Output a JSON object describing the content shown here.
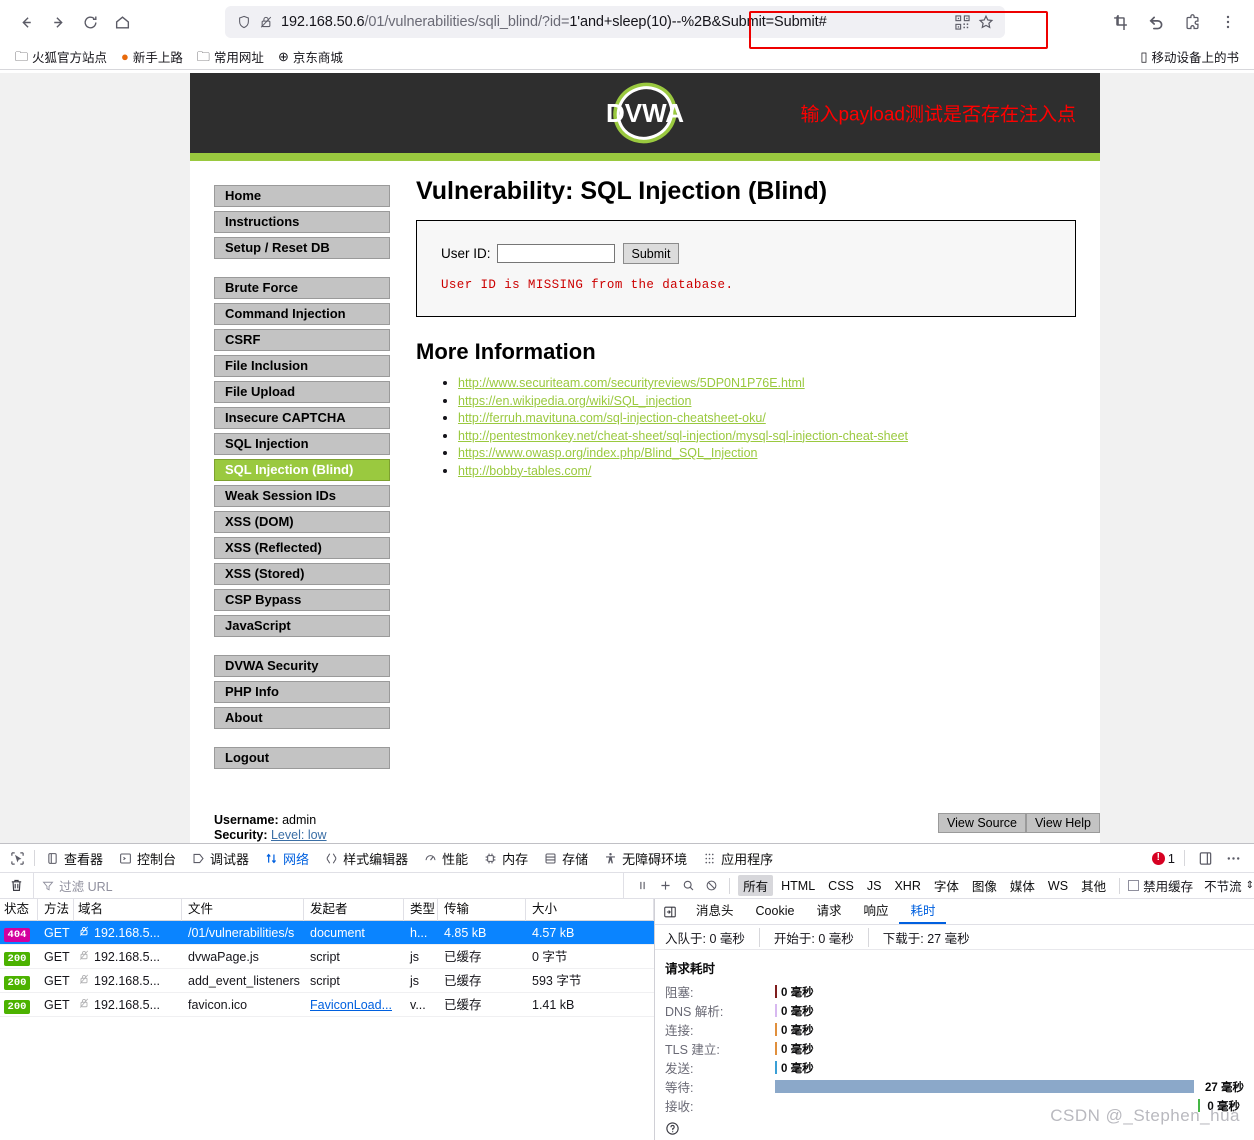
{
  "browser": {
    "nav": {
      "back": "back-arrow",
      "forward": "forward-arrow",
      "reload": "reload",
      "home": "home"
    },
    "url": {
      "host": "192.168.50.6",
      "path": "/01/vulnerabilities/sqli_blind/?id=",
      "query": "1'and+sleep(10)--%2B&Submit=Submit#",
      "full": "192.168.50.6/01/vulnerabilities/sqli_blind/?id=1'and+sleep(10)--%2B&Submit=Submit#"
    },
    "bookmarks": [
      {
        "label": "火狐官方站点",
        "icon": "folder-icon"
      },
      {
        "label": "新手上路",
        "icon": "firefox-icon"
      },
      {
        "label": "常用网址",
        "icon": "folder-icon"
      },
      {
        "label": "京东商城",
        "icon": "globe-icon"
      }
    ],
    "bookmarks_right": {
      "label": "移动设备上的书",
      "icon": "mobile-icon"
    }
  },
  "dvwa": {
    "logo": "DVWA",
    "header_annotation": "输入payload测试是否存在注入点",
    "menu_groups": [
      {
        "items": [
          {
            "label": "Home",
            "active": false
          },
          {
            "label": "Instructions",
            "active": false
          },
          {
            "label": "Setup / Reset DB",
            "active": false
          }
        ]
      },
      {
        "items": [
          {
            "label": "Brute Force",
            "active": false
          },
          {
            "label": "Command Injection",
            "active": false
          },
          {
            "label": "CSRF",
            "active": false
          },
          {
            "label": "File Inclusion",
            "active": false
          },
          {
            "label": "File Upload",
            "active": false
          },
          {
            "label": "Insecure CAPTCHA",
            "active": false
          },
          {
            "label": "SQL Injection",
            "active": false
          },
          {
            "label": "SQL Injection (Blind)",
            "active": true
          },
          {
            "label": "Weak Session IDs",
            "active": false
          },
          {
            "label": "XSS (DOM)",
            "active": false
          },
          {
            "label": "XSS (Reflected)",
            "active": false
          },
          {
            "label": "XSS (Stored)",
            "active": false
          },
          {
            "label": "CSP Bypass",
            "active": false
          },
          {
            "label": "JavaScript",
            "active": false
          }
        ]
      },
      {
        "items": [
          {
            "label": "DVWA Security",
            "active": false
          },
          {
            "label": "PHP Info",
            "active": false
          },
          {
            "label": "About",
            "active": false
          }
        ]
      },
      {
        "items": [
          {
            "label": "Logout",
            "active": false
          }
        ]
      }
    ],
    "title": "Vulnerability: SQL Injection (Blind)",
    "form": {
      "label": "User ID:",
      "input_value": "",
      "input_placeholder": "",
      "submit_label": "Submit"
    },
    "result_message": "User ID is MISSING from the database.",
    "more_info_title": "More Information",
    "more_info_links": [
      "http://www.securiteam.com/securityreviews/5DP0N1P76E.html",
      "https://en.wikipedia.org/wiki/SQL_injection",
      "http://ferruh.mavituna.com/sql-injection-cheatsheet-oku/",
      "http://pentestmonkey.net/cheat-sheet/sql-injection/mysql-sql-injection-cheat-sheet",
      "https://www.owasp.org/index.php/Blind_SQL_Injection",
      "http://bobby-tables.com/"
    ],
    "footer": {
      "username_label": "Username:",
      "username_value": "admin",
      "security_label": "Security:",
      "security_value": "Level: low"
    },
    "view_source_label": "View Source",
    "view_help_label": "View Help"
  },
  "devtools": {
    "tabs": [
      {
        "label": "查看器",
        "icon": "inspector-icon",
        "active": false
      },
      {
        "label": "控制台",
        "icon": "console-icon",
        "active": false
      },
      {
        "label": "调试器",
        "icon": "debugger-icon",
        "active": false
      },
      {
        "label": "网络",
        "icon": "network-icon",
        "active": true
      },
      {
        "label": "样式编辑器",
        "icon": "style-editor-icon",
        "active": false
      },
      {
        "label": "性能",
        "icon": "performance-icon",
        "active": false
      },
      {
        "label": "内存",
        "icon": "memory-icon",
        "active": false
      },
      {
        "label": "存储",
        "icon": "storage-icon",
        "active": false
      },
      {
        "label": "无障碍环境",
        "icon": "accessibility-icon",
        "active": false
      },
      {
        "label": "应用程序",
        "icon": "application-icon",
        "active": false
      }
    ],
    "error_count": "1",
    "filter_placeholder": "过滤 URL",
    "filter_buttons": [
      {
        "label": "所有",
        "on": true
      },
      {
        "label": "HTML",
        "on": false
      },
      {
        "label": "CSS",
        "on": false
      },
      {
        "label": "JS",
        "on": false
      },
      {
        "label": "XHR",
        "on": false
      },
      {
        "label": "字体",
        "on": false
      },
      {
        "label": "图像",
        "on": false
      },
      {
        "label": "媒体",
        "on": false
      },
      {
        "label": "WS",
        "on": false
      },
      {
        "label": "其他",
        "on": false
      }
    ],
    "disable_cache_label": "禁用缓存",
    "throttle_label": "不节流",
    "columns": [
      "状态",
      "方法",
      "域名",
      "文件",
      "发起者",
      "类型",
      "传输",
      "大小"
    ],
    "requests": [
      {
        "status": "404",
        "status_type": "404",
        "method": "GET",
        "domain": "192.168.5...",
        "file": "/01/vulnerabilities/s",
        "initiator": "document",
        "type": "h...",
        "transfer": "4.85 kB",
        "size": "4.57 kB",
        "selected": true,
        "initiator_link": false
      },
      {
        "status": "200",
        "status_type": "200",
        "method": "GET",
        "domain": "192.168.5...",
        "file": "dvwaPage.js",
        "initiator": "script",
        "type": "js",
        "transfer": "已缓存",
        "size": "0 字节",
        "selected": false,
        "initiator_link": false
      },
      {
        "status": "200",
        "status_type": "200",
        "method": "GET",
        "domain": "192.168.5...",
        "file": "add_event_listeners",
        "initiator": "script",
        "type": "js",
        "transfer": "已缓存",
        "size": "593 字节",
        "selected": false,
        "initiator_link": false
      },
      {
        "status": "200",
        "status_type": "200",
        "method": "GET",
        "domain": "192.168.5...",
        "file": "favicon.ico",
        "initiator": "FaviconLoad...",
        "type": "v...",
        "transfer": "已缓存",
        "size": "1.41 kB",
        "selected": false,
        "initiator_link": true
      }
    ],
    "detail_tabs": [
      {
        "label": "消息头",
        "active": false
      },
      {
        "label": "Cookie",
        "active": false
      },
      {
        "label": "请求",
        "active": false
      },
      {
        "label": "响应",
        "active": false
      },
      {
        "label": "耗时",
        "active": true
      }
    ],
    "detail_summary": [
      "入队于: 0 毫秒",
      "开始于: 0 毫秒",
      "下载于: 27 毫秒"
    ],
    "timing_title": "请求耗时",
    "timings": [
      {
        "label": "阻塞:",
        "value": "0 毫秒",
        "pct": 0,
        "color": "#7f1d1d"
      },
      {
        "label": "DNS 解析:",
        "value": "0 毫秒",
        "pct": 0,
        "color": "#d7b8f0"
      },
      {
        "label": "连接:",
        "value": "0 毫秒",
        "pct": 0,
        "color": "#e08f3c"
      },
      {
        "label": "TLS 建立:",
        "value": "0 毫秒",
        "pct": 0,
        "color": "#e08f3c"
      },
      {
        "label": "发送:",
        "value": "0 毫秒",
        "pct": 0,
        "color": "#3a9fd6"
      },
      {
        "label": "等待:",
        "value": "27 毫秒",
        "pct": 100,
        "color": "#8ba8c9"
      },
      {
        "label": "接收:",
        "value": "0 毫秒",
        "pct": 0,
        "color": "#45b645"
      }
    ],
    "watermark": "CSDN @_Stephen_huà"
  }
}
